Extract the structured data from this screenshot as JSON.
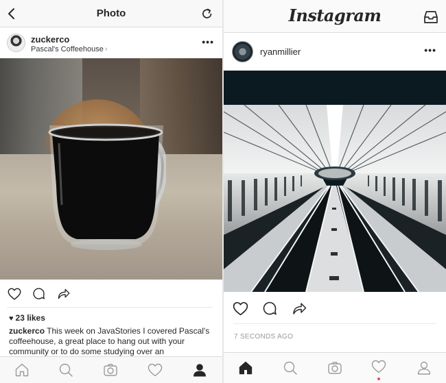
{
  "left_screen": {
    "header": {
      "title": "Photo"
    },
    "post": {
      "username": "zuckerco",
      "location": "Pascal's Coffeehouse",
      "location_chevron": "›",
      "more_label": "•••",
      "likes": "23 likes",
      "caption_user": "zuckerco",
      "caption_text": " This week on JavaStories I covered Pascal's coffeehouse, a great place to hang out with your community or to do some studying over an"
    },
    "tabbar": [
      "home-icon",
      "search-icon",
      "camera-icon",
      "heart-icon",
      "profile-icon"
    ],
    "active_tab": "profile-icon"
  },
  "right_screen": {
    "header": {
      "logo": "Instagram"
    },
    "post": {
      "username": "ryanmillier",
      "more_label": "•••",
      "timestamp": "7 SECONDS AGO"
    },
    "tabbar": [
      "home-icon",
      "search-icon",
      "camera-icon",
      "heart-icon",
      "profile-icon"
    ],
    "active_tab": "home-icon",
    "notification_color": "#ed4956"
  },
  "colors": {
    "text": "#262626",
    "muted": "#999999",
    "bar_background": "#f8f8f8",
    "border": "#dcdcdc"
  }
}
